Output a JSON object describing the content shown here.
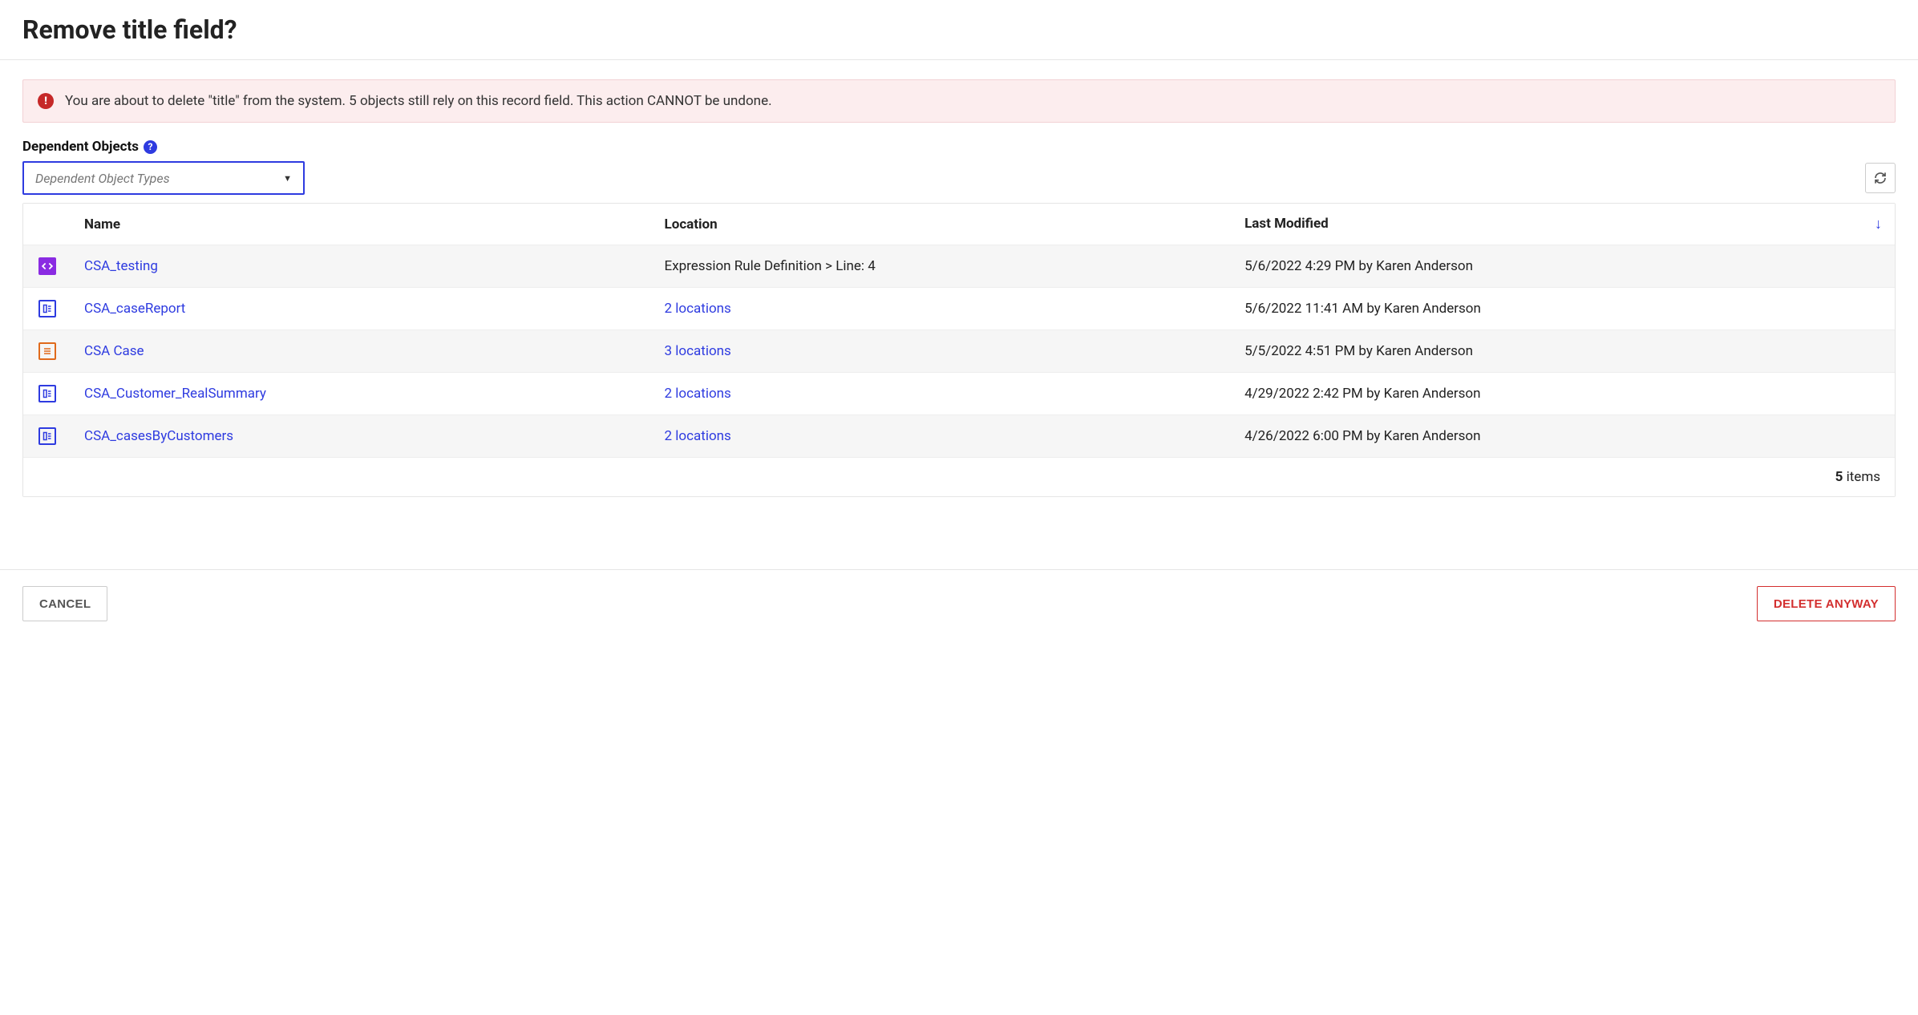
{
  "title": "Remove title field?",
  "warning": {
    "text": "You are about to delete \"title\" from the system. 5 objects still rely on this record field. This action CANNOT be undone."
  },
  "section_label": "Dependent Objects",
  "filter": {
    "placeholder": "Dependent Object Types"
  },
  "columns": {
    "name": "Name",
    "location": "Location",
    "last_modified": "Last Modified"
  },
  "rows": [
    {
      "icon_type": "code",
      "name": "CSA_testing",
      "location_text": "Expression Rule Definition > Line: 4",
      "location_is_link": false,
      "last_modified": "5/6/2022 4:29 PM by Karen Anderson"
    },
    {
      "icon_type": "interface",
      "name": "CSA_caseReport",
      "location_text": "2 locations",
      "location_is_link": true,
      "last_modified": "5/6/2022 11:41 AM by Karen Anderson"
    },
    {
      "icon_type": "record",
      "name": "CSA Case",
      "location_text": "3 locations",
      "location_is_link": true,
      "last_modified": "5/5/2022 4:51 PM by Karen Anderson"
    },
    {
      "icon_type": "interface",
      "name": "CSA_Customer_RealSummary",
      "location_text": "2 locations",
      "location_is_link": true,
      "last_modified": "4/29/2022 2:42 PM by Karen Anderson"
    },
    {
      "icon_type": "interface",
      "name": "CSA_casesByCustomers",
      "location_text": "2 locations",
      "location_is_link": true,
      "last_modified": "4/26/2022 6:00 PM by Karen Anderson"
    }
  ],
  "footer": {
    "count": "5",
    "items_label": " items"
  },
  "buttons": {
    "cancel": "CANCEL",
    "delete": "DELETE ANYWAY"
  }
}
